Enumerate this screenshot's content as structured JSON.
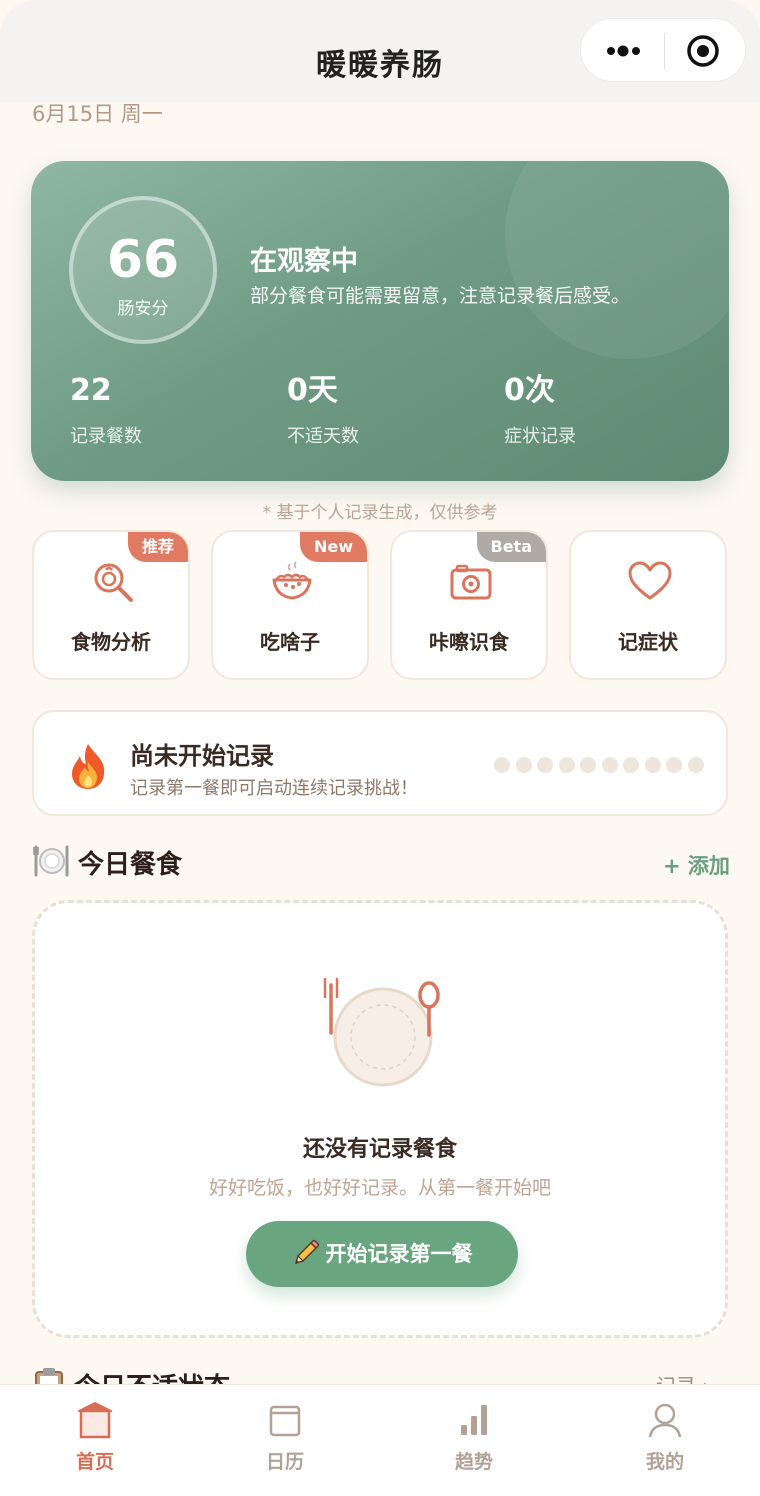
{
  "app": {
    "title": "暖暖养肠"
  },
  "date": "6月15日 周一",
  "score_card": {
    "score": "66",
    "score_label": "肠安分",
    "status_title": "在观察中",
    "status_desc": "部分餐食可能需要留意，注意记录餐后感受。",
    "stats": [
      {
        "value": "22",
        "label": "记录餐数"
      },
      {
        "value": "0天",
        "label": "不适天数"
      },
      {
        "value": "0次",
        "label": "症状记录"
      }
    ],
    "disclaimer": "* 基于个人记录生成，仅供参考"
  },
  "quick_actions": [
    {
      "label": "食物分析",
      "tag": "推荐",
      "icon": "magnifier-icon",
      "tag_color": "#e07a62"
    },
    {
      "label": "吃啥子",
      "tag": "New",
      "icon": "bowl-icon",
      "tag_color": "#e07a62"
    },
    {
      "label": "咔嚓识食",
      "tag": "Beta",
      "icon": "camera-icon",
      "tag_color": "#b0aaa6"
    },
    {
      "label": "记症状",
      "tag": "",
      "icon": "heart-icon",
      "tag_color": ""
    }
  ],
  "streak": {
    "title": "尚未开始记录",
    "desc": "记录第一餐即可启动连续记录挑战！",
    "icon": "fire-icon"
  },
  "meals": {
    "title": "今日餐食",
    "add_label": "+ 添加",
    "empty_title": "还没有记录餐食",
    "empty_desc": "好好吃饭，也好好记录。从第一餐开始吧",
    "start_button": "开始记录第一餐"
  },
  "symptoms": {
    "title": "今日不适状态",
    "link": "记录 ›"
  },
  "tabbar": [
    {
      "label": "首页",
      "icon": "home-icon",
      "active": true
    },
    {
      "label": "日历",
      "icon": "calendar-icon",
      "active": false
    },
    {
      "label": "趋势",
      "icon": "bar-chart-icon",
      "active": false
    },
    {
      "label": "我的",
      "icon": "user-icon",
      "active": false
    }
  ],
  "colors": {
    "accent_green": "#69a67f",
    "accent_red": "#d66e55",
    "background": "#fdf8f2"
  }
}
